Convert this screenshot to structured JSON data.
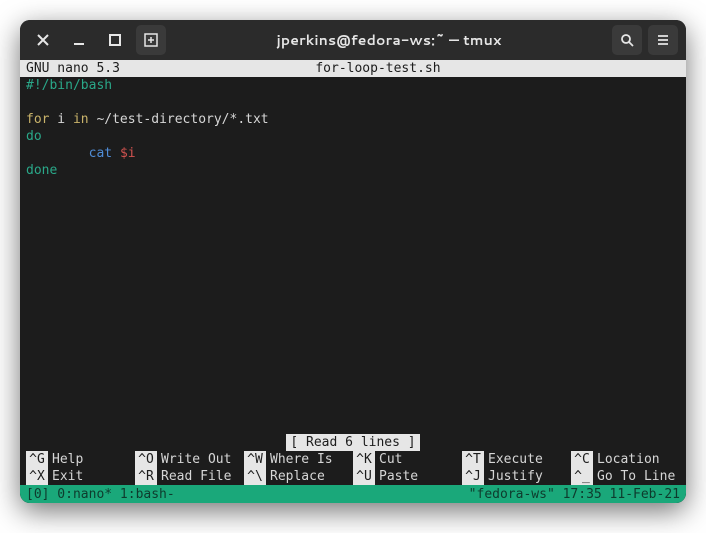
{
  "window": {
    "title": "jperkins@fedora-ws:~ — tmux"
  },
  "nano": {
    "version": "GNU nano 5.3",
    "filename": "for-loop-test.sh",
    "status": "[ Read 6 lines ]",
    "code": {
      "shebang": "#!/bin/bash",
      "for_kw": "for",
      "var": " i ",
      "in_kw": "in",
      "glob": " ~/test-directory/*.txt",
      "do_kw": "do",
      "indent": "        ",
      "cmd": "cat ",
      "arg": "$i",
      "done_kw": "done"
    },
    "shortcuts": {
      "row1": [
        {
          "key": "^G",
          "label": "Help"
        },
        {
          "key": "^O",
          "label": "Write Out"
        },
        {
          "key": "^W",
          "label": "Where Is"
        },
        {
          "key": "^K",
          "label": "Cut"
        },
        {
          "key": "^T",
          "label": "Execute"
        },
        {
          "key": "^C",
          "label": "Location"
        }
      ],
      "row2": [
        {
          "key": "^X",
          "label": "Exit"
        },
        {
          "key": "^R",
          "label": "Read File"
        },
        {
          "key": "^\\",
          "label": "Replace"
        },
        {
          "key": "^U",
          "label": "Paste"
        },
        {
          "key": "^J",
          "label": "Justify"
        },
        {
          "key": "^_",
          "label": "Go To Line"
        }
      ]
    }
  },
  "tmux": {
    "left": "[0] 0:nano* 1:bash-",
    "host": "\"fedora-ws\"",
    "time": " 17:35 11-Feb-21"
  }
}
